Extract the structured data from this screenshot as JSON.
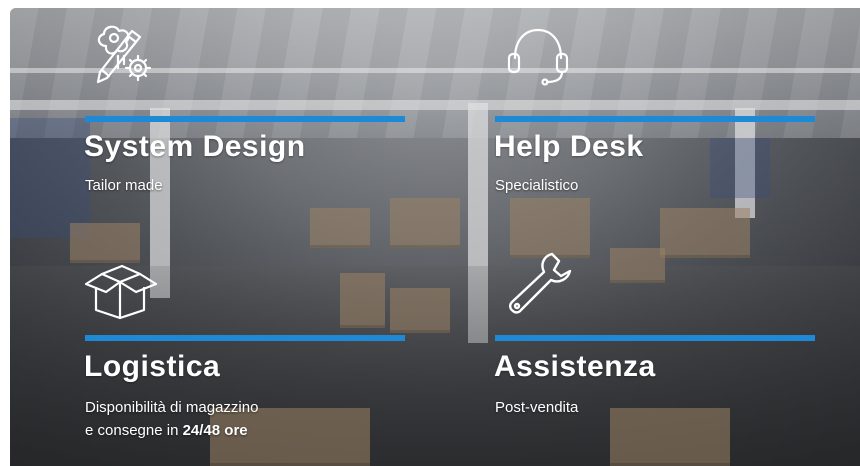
{
  "features": [
    {
      "icon": "design-tools-icon",
      "title": "System Design",
      "subtitle": "Tailor made"
    },
    {
      "icon": "headset-icon",
      "title": "Help Desk",
      "subtitle": "Specialistico"
    },
    {
      "icon": "box-icon",
      "title": "Logistica",
      "subtitle_line1": "Disponibilità di magazzino",
      "subtitle_line2_prefix": "e consegne in ",
      "subtitle_line2_bold": "24/48 ore"
    },
    {
      "icon": "wrench-icon",
      "title": "Assistenza",
      "subtitle": "Post-vendita"
    }
  ],
  "colors": {
    "accent_bar": "#1e8ad6",
    "text": "#ffffff"
  }
}
